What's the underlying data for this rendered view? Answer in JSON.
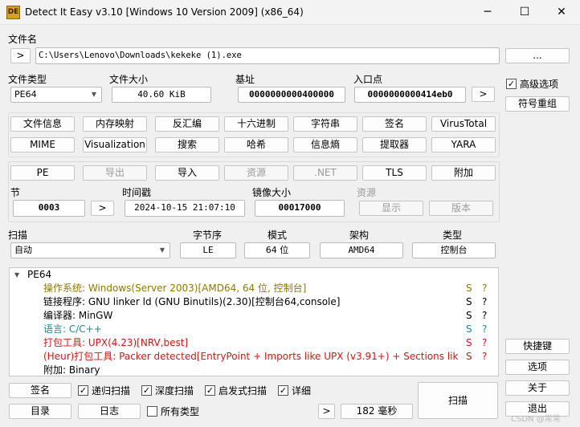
{
  "window": {
    "title": "Detect It Easy v3.10 [Windows 10 Version 2009] (x86_64)",
    "icon": "die-app-icon",
    "minimize": "─",
    "maximize": "☐",
    "close": "✕"
  },
  "file": {
    "label": "文件名",
    "path_btn": ">",
    "path": "C:\\Users\\Lenovo\\Downloads\\kekeke (1).exe",
    "browse_btn": "..."
  },
  "info": {
    "type_label": "文件类型",
    "type_value": "PE64",
    "size_label": "文件大小",
    "size_value": "40.60 KiB",
    "base_label": "基址",
    "base_value": "0000000000400000",
    "entry_label": "入口点",
    "entry_value": "0000000000414eb0",
    "entry_btn": ">"
  },
  "right_panel": {
    "advanced_label": "高级选项",
    "advanced_checked": "✓",
    "rebuild_btn": "符号重组",
    "shortcuts_btn": "快捷键",
    "options_btn": "选项",
    "about_btn": "关于",
    "exit_btn": "退出"
  },
  "tools_row1": [
    "文件信息",
    "内存映射",
    "反汇编",
    "十六进制",
    "字符串",
    "签名",
    "VirusTotal"
  ],
  "tools_row2": [
    "MIME",
    "Visualization",
    "搜索",
    "哈希",
    "信息熵",
    "提取器",
    "YARA"
  ],
  "pe_row": [
    "PE",
    "导出",
    "导入",
    "资源",
    ".NET",
    "TLS",
    "附加"
  ],
  "sections": {
    "section_label": "节",
    "section_value": "0003",
    "section_btn": ">",
    "timestamp_label": "时间戳",
    "timestamp_value": "2024-10-15 21:07:10",
    "image_size_label": "镜像大小",
    "image_size_value": "00017000",
    "resources_label": "资源",
    "show_btn": "显示",
    "version_btn": "版本"
  },
  "scan": {
    "scan_label": "扫描",
    "scan_mode": "自动",
    "endian_label": "字节序",
    "endian_value": "LE",
    "mode_label": "模式",
    "mode_value": "64 位",
    "arch_label": "架构",
    "arch_value": "AMD64",
    "type_label": "类型",
    "type_value": "控制台"
  },
  "results": {
    "root": "PE64",
    "expander": "▼",
    "rows": [
      {
        "text": "操作系统: Windows(Server 2003)[AMD64, 64 位, 控制台]",
        "s": "S",
        "q": "?",
        "color": "#8a7a00"
      },
      {
        "text": "链接程序: GNU linker ld (GNU Binutils)(2.30)[控制台64,console]",
        "s": "S",
        "q": "?",
        "color": "#000000"
      },
      {
        "text": "编译器: MinGW",
        "s": "S",
        "q": "?",
        "color": "#000000"
      },
      {
        "text": "语言: C/C++",
        "s": "S",
        "q": "?",
        "color": "#1d8a8a"
      },
      {
        "text": "打包工具: UPX(4.23)[NRV,best]",
        "s": "S",
        "q": "?",
        "color": "#e01010"
      },
      {
        "text": "(Heur)打包工具: Packer detected[EntryPoint + Imports like UPX (v3.91+) + Sections like ...",
        "s": "S",
        "q": "?",
        "color": "#e01010"
      },
      {
        "text": "附加: Binary",
        "s": "",
        "q": "",
        "color": "#000000"
      }
    ]
  },
  "bottom": {
    "signatures_btn": "签名",
    "recursive_label": "递归扫描",
    "deep_label": "深度扫描",
    "heuristic_label": "启发式扫描",
    "verbose_label": "详细",
    "check": "✓",
    "directory_btn": "目录",
    "log_btn": "日志",
    "all_types_label": "所有类型",
    "time_btn": ">",
    "time_value": "182 毫秒",
    "scan_btn": "扫描"
  },
  "watermark": "CSDN @常常"
}
